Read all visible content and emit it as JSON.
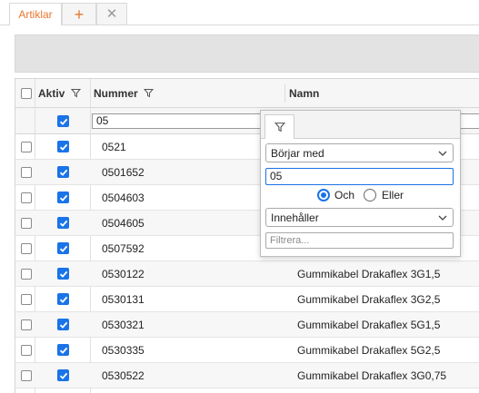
{
  "tabs": {
    "active_label": "Artiklar",
    "add_symbol": "+",
    "close_symbol": "✕"
  },
  "grid": {
    "columns": [
      {
        "label": "Aktiv",
        "has_filter_icon": true
      },
      {
        "label": "Nummer",
        "has_filter_icon": true
      },
      {
        "label": "Namn",
        "has_filter_icon": false
      }
    ],
    "filter_row": {
      "aktiv_checked": true,
      "nummer_value": "05"
    },
    "rows": [
      {
        "selected": false,
        "aktiv": true,
        "nummer": "0521",
        "namn": ""
      },
      {
        "selected": false,
        "aktiv": true,
        "nummer": "0501652",
        "namn": ""
      },
      {
        "selected": false,
        "aktiv": true,
        "nummer": "0504603",
        "namn": ""
      },
      {
        "selected": false,
        "aktiv": true,
        "nummer": "0504605",
        "namn": ""
      },
      {
        "selected": false,
        "aktiv": true,
        "nummer": "0507592",
        "namn": ""
      },
      {
        "selected": false,
        "aktiv": true,
        "nummer": "0530122",
        "namn": "Gummikabel Drakaflex 3G1,5"
      },
      {
        "selected": false,
        "aktiv": true,
        "nummer": "0530131",
        "namn": "Gummikabel Drakaflex 3G2,5"
      },
      {
        "selected": false,
        "aktiv": true,
        "nummer": "0530321",
        "namn": "Gummikabel Drakaflex 5G1,5"
      },
      {
        "selected": false,
        "aktiv": true,
        "nummer": "0530335",
        "namn": "Gummikabel Drakaflex 5G2,5"
      },
      {
        "selected": false,
        "aktiv": true,
        "nummer": "0530522",
        "namn": "Gummikabel Drakaflex 3G0,75"
      }
    ]
  },
  "filter_popup": {
    "condition1": "Börjar med",
    "value1": "05",
    "logic_and": "Och",
    "logic_or": "Eller",
    "logic_selected": "and",
    "condition2": "Innehåller",
    "value2_placeholder": "Filtrera..."
  },
  "colors": {
    "accent": "#e8772e",
    "checkbox": "#1a73e8"
  }
}
